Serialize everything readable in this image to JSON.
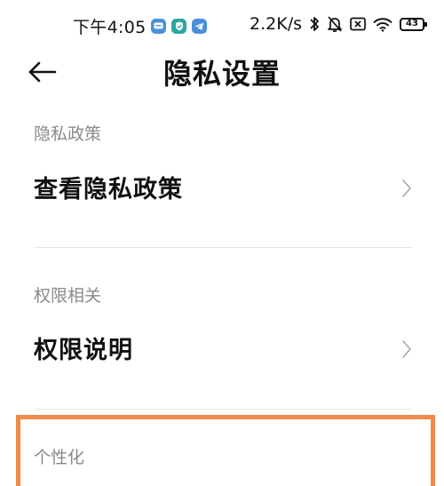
{
  "status_bar": {
    "time": "下午4:05",
    "net_speed": "2.2K/s",
    "battery_level": "43",
    "app_icons": [
      "message-app-icon",
      "shield-app-icon",
      "telegram-app-icon"
    ],
    "indicator_icons": [
      "bluetooth-icon",
      "muted-bell-icon",
      "sim-off-icon",
      "wifi-icon",
      "battery-icon"
    ]
  },
  "header": {
    "title": "隐私设置",
    "back_icon": "back-arrow-icon"
  },
  "sections": [
    {
      "label": "隐私政策",
      "item": "查看隐私政策"
    },
    {
      "label": "权限相关",
      "item": "权限说明"
    },
    {
      "label": "个性化"
    }
  ],
  "colors": {
    "highlight": "#f08a4b",
    "section_label": "#8a8a8a",
    "divider": "#e6e6e6",
    "badge_blue": "#4a8fd8",
    "badge_teal": "#2aa7a0"
  }
}
